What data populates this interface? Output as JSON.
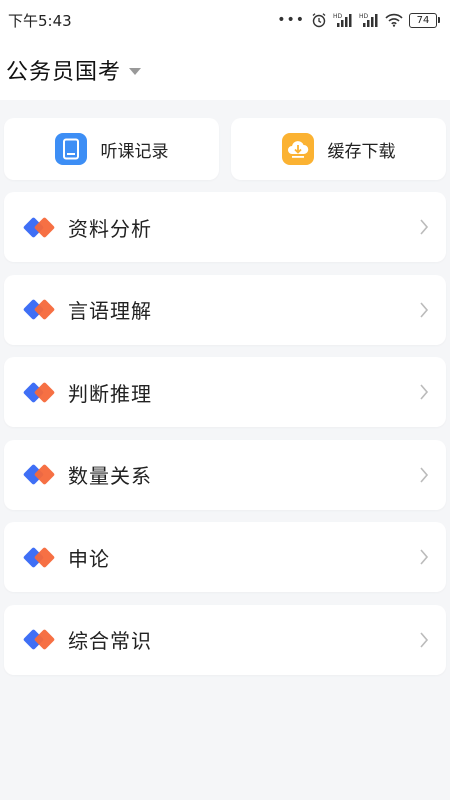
{
  "status_bar": {
    "time": "下午5:43",
    "battery": "74",
    "signal_labels": [
      "HD",
      "HD"
    ]
  },
  "header": {
    "title": "公务员国考"
  },
  "quick_actions": [
    {
      "label": "听课记录",
      "icon": "notebook-icon",
      "color": "#3d8ef5"
    },
    {
      "label": "缓存下载",
      "icon": "download-cloud-icon",
      "color": "#fbb232"
    }
  ],
  "subjects": [
    {
      "label": "资料分析"
    },
    {
      "label": "言语理解"
    },
    {
      "label": "判断推理"
    },
    {
      "label": "数量关系"
    },
    {
      "label": "申论"
    },
    {
      "label": "综合常识"
    }
  ],
  "colors": {
    "diamond_blue": "#3f6ff5",
    "diamond_orange": "#f5683a",
    "background": "#f5f6f8"
  }
}
